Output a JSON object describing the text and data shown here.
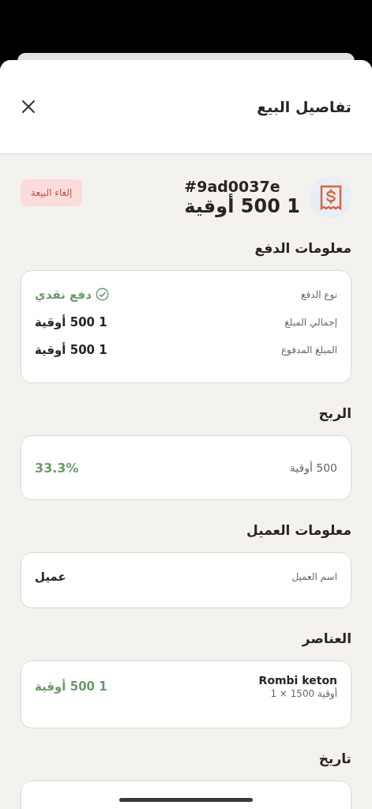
{
  "sheet": {
    "title": "تفاصيل البيع"
  },
  "sale": {
    "id": "#9ad0037e",
    "total": "1 500 أوقية",
    "cancel_button": "إلغاء البيعة"
  },
  "payment": {
    "heading": "معلومات الدفع",
    "rows": [
      {
        "kind": "method",
        "label": "نوع الدفع",
        "value": "دفع نقدي"
      },
      {
        "kind": "amount",
        "label": "إجمالي المبلغ",
        "value": "1 500 أوقية"
      },
      {
        "kind": "amount",
        "label": "المبلغ المدفوع",
        "value": "1 500 أوقية"
      }
    ]
  },
  "profit": {
    "heading": "الربح",
    "amount": "500 أوقية",
    "percent": "33.3%"
  },
  "customer": {
    "heading": "معلومات العميل",
    "label": "اسم العميل",
    "name": "عميل"
  },
  "items": {
    "heading": "العناصر",
    "list": [
      {
        "name": "Rombi keton",
        "detail": "أوقية 1500 × 1",
        "total": "1 500 أوقية"
      }
    ]
  },
  "date": {
    "heading": "تاريخ"
  }
}
